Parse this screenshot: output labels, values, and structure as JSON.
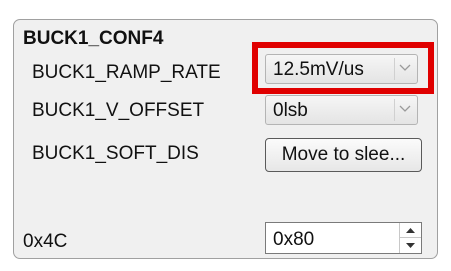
{
  "group": {
    "title": "BUCK1_CONF4"
  },
  "fields": {
    "ramp_rate": {
      "label": "BUCK1_RAMP_RATE",
      "value": "12.5mV/us"
    },
    "v_offset": {
      "label": "BUCK1_V_OFFSET",
      "value": "0lsb"
    },
    "soft_dis": {
      "label": "BUCK1_SOFT_DIS",
      "value": "Move to slee..."
    }
  },
  "register": {
    "address": "0x4C",
    "value": "0x80"
  },
  "icons": {
    "dropdown": "chevron-down-icon",
    "spin_up": "triangle-up-icon",
    "spin_down": "triangle-down-icon"
  },
  "colors": {
    "highlight": "#e00000",
    "panel_background": "#f0f0f0"
  }
}
